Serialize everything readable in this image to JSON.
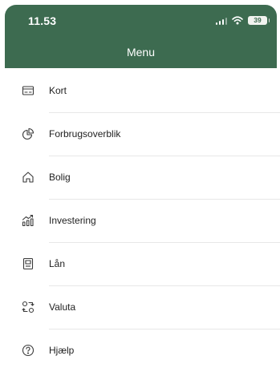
{
  "status_bar": {
    "time": "11.53",
    "battery": "39"
  },
  "header": {
    "title": "Menu"
  },
  "menu": {
    "items": [
      {
        "label": "Kort",
        "icon": "card-icon"
      },
      {
        "label": "Forbrugsoverblik",
        "icon": "pie-chart-icon"
      },
      {
        "label": "Bolig",
        "icon": "house-icon"
      },
      {
        "label": "Investering",
        "icon": "investment-chart-icon"
      },
      {
        "label": "Lån",
        "icon": "loan-icon"
      },
      {
        "label": "Valuta",
        "icon": "currency-exchange-icon"
      },
      {
        "label": "Hjælp",
        "icon": "help-icon"
      }
    ]
  },
  "colors": {
    "header_bg": "#3d6b50",
    "text": "#1f1f1f",
    "divider": "#e8e8e8",
    "icon": "#3a3a3a"
  }
}
